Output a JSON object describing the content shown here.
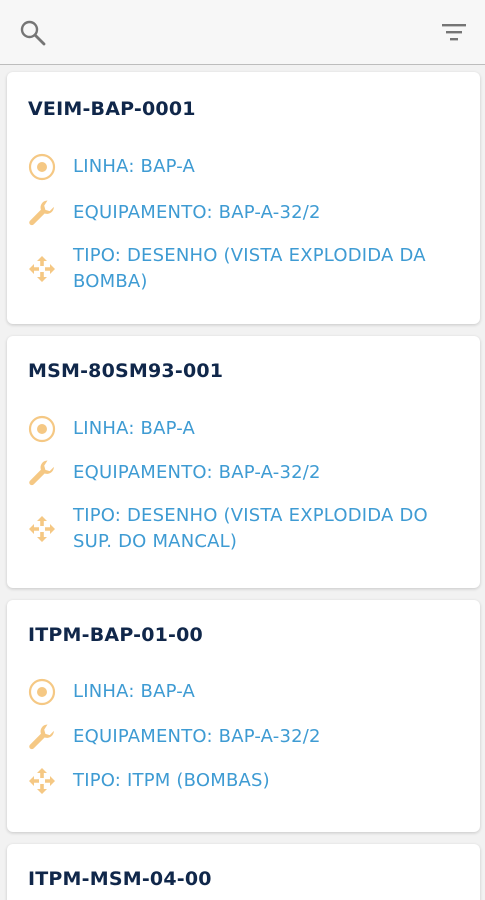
{
  "toolbar": {
    "search_icon": "search-icon",
    "filter_icon": "filter-icon"
  },
  "colors": {
    "title": "#10274a",
    "detail_text": "#3e9bd3",
    "icon": "#f5c884",
    "background": "#f2f2f2"
  },
  "documents": [
    {
      "code": "VEIM-BAP-0001",
      "linha": "LINHA: BAP-A",
      "equipamento": "EQUIPAMENTO: BAP-A-32/2",
      "tipo": "TIPO: DESENHO (VISTA EXPLODIDA DA BOMBA)"
    },
    {
      "code": "MSM-80SM93-001",
      "linha": "LINHA: BAP-A",
      "equipamento": "EQUIPAMENTO: BAP-A-32/2",
      "tipo": "TIPO: DESENHO (VISTA EXPLODIDA DO SUP. DO MANCAL)"
    },
    {
      "code": "ITPM-BAP-01-00",
      "linha": "LINHA: BAP-A",
      "equipamento": "EQUIPAMENTO: BAP-A-32/2",
      "tipo": "TIPO: ITPM (BOMBAS)"
    },
    {
      "code": "ITPM-MSM-04-00"
    }
  ]
}
